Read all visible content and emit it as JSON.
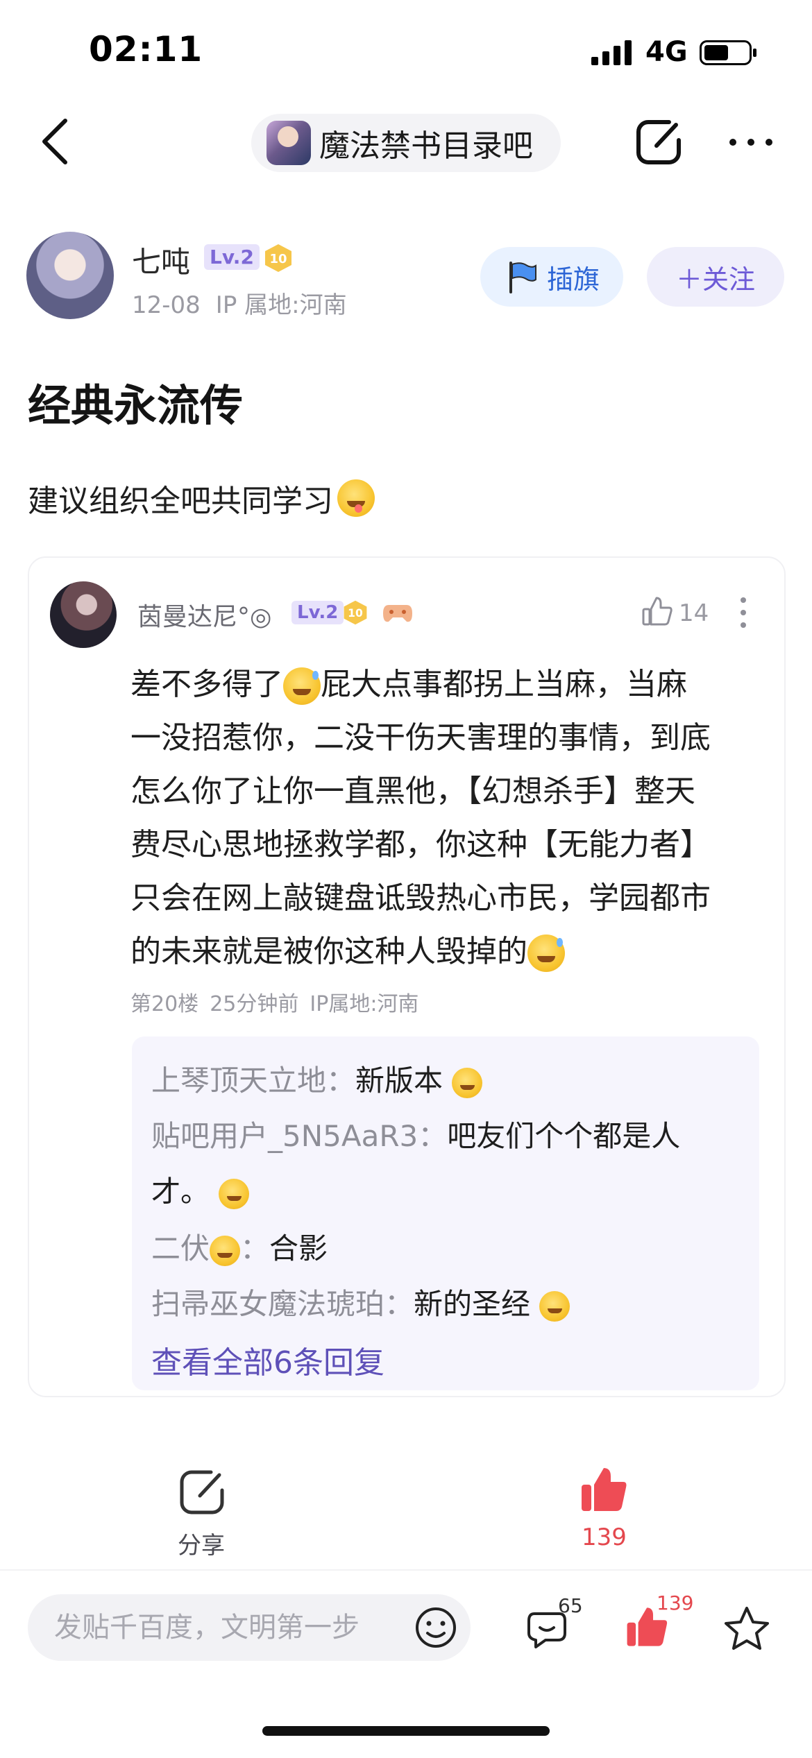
{
  "status_bar": {
    "time": "02:11",
    "network": "4G",
    "battery_level": 0.5
  },
  "nav": {
    "forum_name": "魔法禁书目录吧"
  },
  "author": {
    "name": "七吨",
    "level": "Lv.2",
    "medal_number": "10",
    "date": "12-08",
    "ip": "IP 属地:河南"
  },
  "buttons": {
    "flag": "插旗",
    "follow": "＋关注"
  },
  "post": {
    "title": "经典永流传",
    "body": "建议组织全吧共同学习"
  },
  "comment": {
    "name": "茵曼达尼°◎",
    "level": "Lv.2",
    "medal_number": "10",
    "like_count": "14",
    "text_lines": [
      "差不多得了",
      "屁大点事都拐上当麻，当麻",
      "一没招惹你，二没干伤天害理的事情，到底",
      "怎么你了让你一直黑他，【幻想杀手】整天",
      "费尽心思地拯救学都，你这种【无能力者】",
      "只会在网上敲键盘诋毁热心市民，学园都市",
      "的未来就是被你这种人毁掉的"
    ],
    "floor": "第20楼",
    "time": "25分钟前",
    "ip": "IP属地:河南",
    "replies": [
      {
        "user": "上琴顶天立地",
        "sep": "：",
        "text": "新版本"
      },
      {
        "user": "贴吧用户_5N5AaR3",
        "sep": "：",
        "text": "吧友们个个都是人",
        "text_cont": "才。"
      },
      {
        "user": "二伏",
        "sep": "：",
        "text": "合影"
      },
      {
        "user": "扫帚巫女魔法琥珀",
        "sep": "：",
        "text": "新的圣经"
      }
    ],
    "view_all": "查看全部6条回复"
  },
  "actions": {
    "share_label": "分享",
    "like_count": "139"
  },
  "bottom_bar": {
    "input_placeholder": "发贴千百度，文明第一步",
    "comment_count": "65",
    "like_count": "139"
  },
  "colors": {
    "accent_purple": "#6d5ad7",
    "like_red": "#e4474d",
    "flag_blue": "#2d66d6"
  }
}
